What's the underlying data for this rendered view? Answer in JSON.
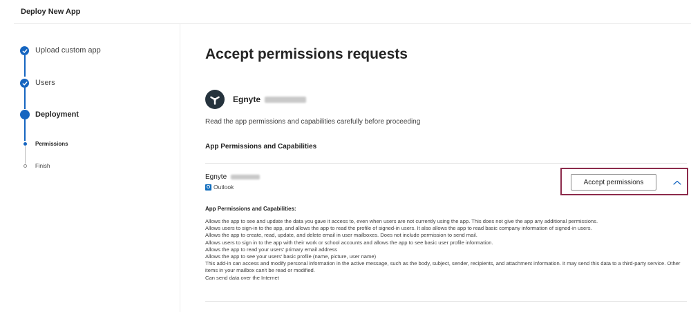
{
  "header": {
    "title": "Deploy New App"
  },
  "steps": [
    {
      "label": "Upload custom app",
      "state": "complete"
    },
    {
      "label": "Users",
      "state": "complete"
    },
    {
      "label": "Deployment",
      "state": "current"
    },
    {
      "label": "Permissions",
      "state": "current-sub"
    },
    {
      "label": "Finish",
      "state": "pending"
    }
  ],
  "main": {
    "title": "Accept permissions requests",
    "app_name": "Egnyte",
    "intro": "Read the app permissions and capabilities carefully before proceeding",
    "section_heading": "App Permissions and Capabilities",
    "item": {
      "name": "Egnyte",
      "host": "Outlook",
      "host_icon_letter": "O",
      "accept_label": "Accept permissions",
      "expand_icon": "chevron-up-icon"
    },
    "permissions_heading": "App Permissions and Capabilities:",
    "permissions": [
      "Allows the app to see and update the data you gave it access to, even when users are not currently using the app. This does not give the app any additional permissions.",
      "Allows users to sign-in to the app, and allows the app to read the profile of signed-in users. It also allows the app to read basic company information of signed-in users.",
      "Allows the app to create, read, update, and delete email in user mailboxes. Does not include permission to send mail.",
      "Allows users to sign in to the app with their work or school accounts and allows the app to see basic user profile information.",
      "Allows the app to read your users' primary email address",
      "Allows the app to see your users' basic profile (name, picture, user name)",
      "This add-in can access and modify personal information in the active message, such as the body, subject, sender, recipients, and attachment information. It may send this data to a third-party service. Other items in your mailbox can't be read or modified.",
      "Can send data over the Internet"
    ]
  },
  "colors": {
    "accent": "#1565c0",
    "highlight_border": "#8c2a4b",
    "app_icon_bg": "#25333d",
    "outlook_blue": "#0f6cbd"
  }
}
